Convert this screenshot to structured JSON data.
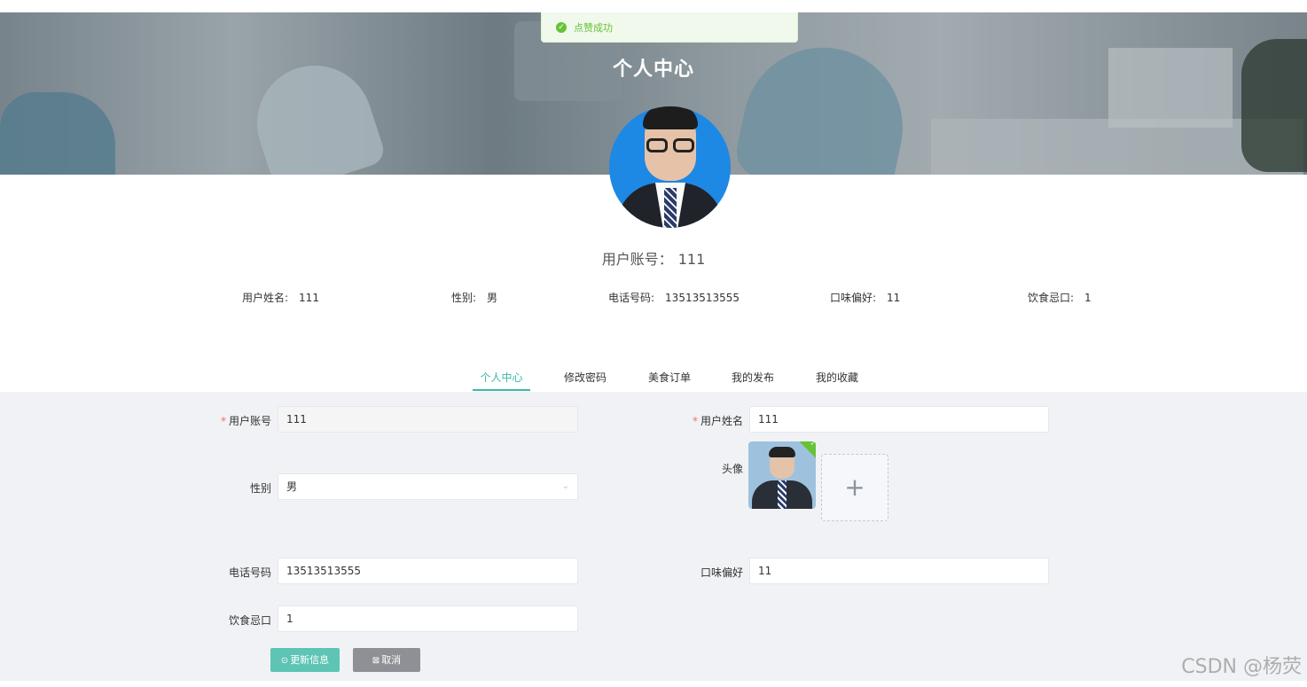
{
  "toast": {
    "message": "点赞成功"
  },
  "banner": {
    "title": "个人中心"
  },
  "profile": {
    "account_label": "用户账号：",
    "account_value": "111",
    "info": [
      {
        "label": "用户姓名:",
        "value": "111"
      },
      {
        "label": "性别:",
        "value": "男"
      },
      {
        "label": "电话号码:",
        "value": "13513513555"
      },
      {
        "label": "口味偏好:",
        "value": "11"
      },
      {
        "label": "饮食忌口:",
        "value": "1"
      }
    ]
  },
  "tabs": [
    {
      "label": "个人中心",
      "active": true
    },
    {
      "label": "修改密码",
      "active": false
    },
    {
      "label": "美食订单",
      "active": false
    },
    {
      "label": "我的发布",
      "active": false
    },
    {
      "label": "我的收藏",
      "active": false
    }
  ],
  "form": {
    "account": {
      "label": "用户账号",
      "value": "111",
      "required": true,
      "disabled": true
    },
    "name": {
      "label": "用户姓名",
      "value": "111",
      "required": true
    },
    "gender": {
      "label": "性别",
      "value": "男"
    },
    "avatar": {
      "label": "头像",
      "add_glyph": "+"
    },
    "phone": {
      "label": "电话号码",
      "value": "13513513555"
    },
    "taste": {
      "label": "口味偏好",
      "value": "11"
    },
    "taboo": {
      "label": "饮食忌口",
      "value": "1"
    },
    "update_label": "更新信息",
    "cancel_label": "取消"
  },
  "icons": {
    "toast_icon": "check-circle-icon",
    "select_icon": "chevron-down-icon",
    "update_icon": "check-circle-icon",
    "cancel_icon": "close-square-icon"
  },
  "colors": {
    "accent": "#3bb8a8",
    "success": "#67c23a",
    "required": "#f56c6c",
    "cancel": "#8e9095"
  },
  "watermark": "CSDN @杨荧"
}
